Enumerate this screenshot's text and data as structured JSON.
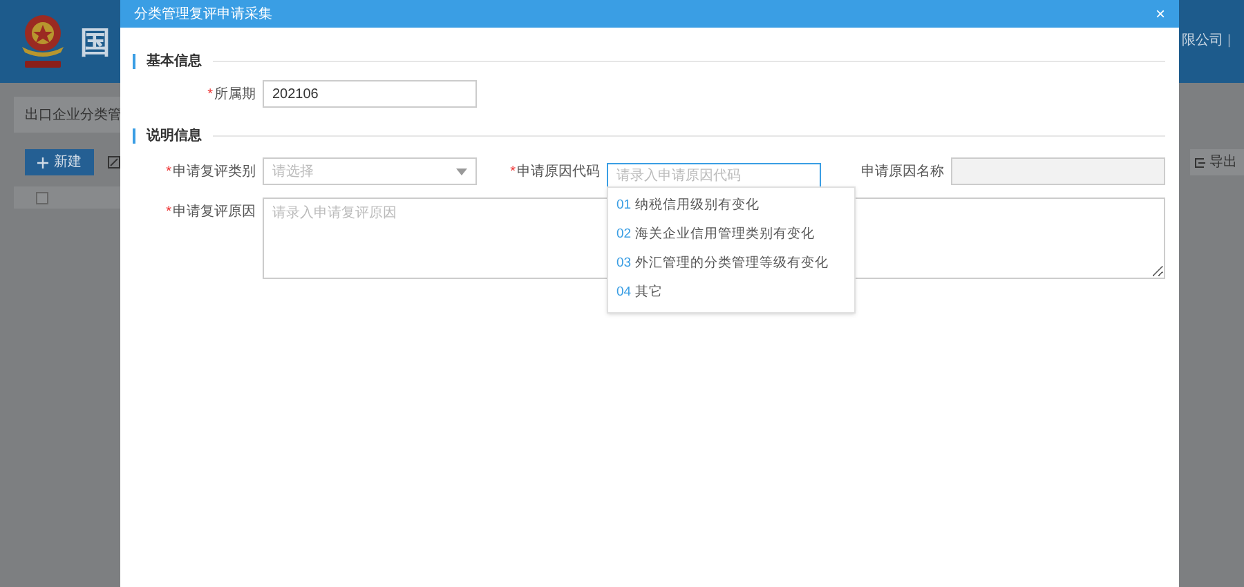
{
  "background": {
    "header_title": "国",
    "header_right": [
      "限公司",
      "|"
    ],
    "breadcrumb": "出口企业分类管",
    "new_button": "新建",
    "export_button": "导出",
    "select_all": {
      "checked": false
    }
  },
  "dialog": {
    "title": "分类管理复评申请采集",
    "close": "×",
    "basic": {
      "title": "基本信息",
      "period": {
        "label": "所属期",
        "marker": "*",
        "value": "202106"
      }
    },
    "detail": {
      "title": "说明信息",
      "category": {
        "label": "申请复评类别",
        "marker": "*",
        "placeholder": "请选择"
      },
      "code": {
        "label": "申请原因代码",
        "marker": "*",
        "placeholder": "请录入申请原因代码",
        "focused": true,
        "options": [
          {
            "code": "01",
            "text": "纳税信用级别有变化"
          },
          {
            "code": "02",
            "text": "海关企业信用管理类别有变化"
          },
          {
            "code": "03",
            "text": "外汇管理的分类管理等级有变化"
          },
          {
            "code": "04",
            "text": "其它"
          }
        ]
      },
      "name": {
        "label": "申请原因名称",
        "disabled": true
      },
      "reason": {
        "label": "申请复评原因",
        "marker": "*",
        "placeholder": "请录入申请复评原因"
      }
    }
  }
}
